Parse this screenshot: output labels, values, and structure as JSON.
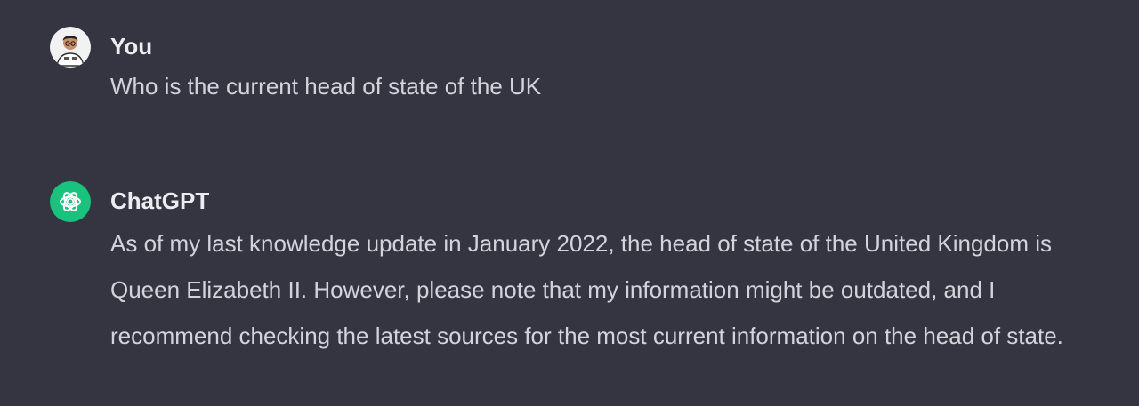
{
  "conversation": {
    "messages": [
      {
        "author": "You",
        "avatar_icon": "user-avatar-icon",
        "text": "Who is the current head of state of the UK"
      },
      {
        "author": "ChatGPT",
        "avatar_icon": "openai-logo-icon",
        "text": "As of my last knowledge update in January 2022, the head of state of the United Kingdom is Queen Elizabeth II. However, please note that my information might be outdated, and I recommend checking the latest sources for the most current information on the head of state."
      }
    ]
  },
  "colors": {
    "background": "#343541",
    "assistant_avatar_bg": "#19c37d",
    "text": "#d1d5db"
  }
}
